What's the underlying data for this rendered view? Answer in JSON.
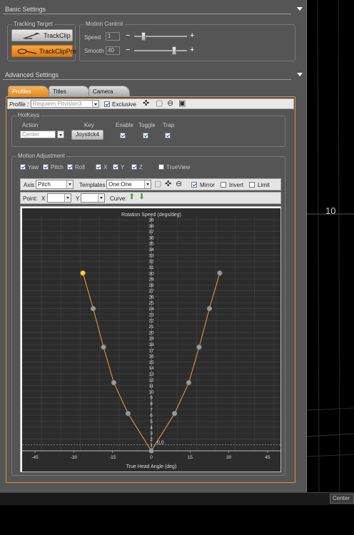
{
  "basic_settings": {
    "title": "Basic Settings"
  },
  "tracking_target": {
    "title": "Tracking Target",
    "trackclip_label": "TrackClip",
    "trackclippro_label": "TrackClipPro"
  },
  "motion_control": {
    "title": "Motion Control",
    "speed_label": "Speed",
    "speed_value": "1",
    "speed_level": 0.18,
    "smooth_label": "Smooth",
    "smooth_value": "40",
    "smooth_level": 0.75,
    "minus": "−",
    "plus": "+"
  },
  "advanced_settings": {
    "title": "Advanced Settings"
  },
  "tabs": {
    "profiles": "Profiles",
    "titles": "Titles",
    "camera": "Camera"
  },
  "profile": {
    "label": "Profile :",
    "value": "Requiem Pitvision3",
    "exclusive_label": "Exclusive",
    "exclusive_checked": true
  },
  "hotkeys": {
    "title": "HotKeys",
    "col_action": "Action",
    "col_key": "Key",
    "col_enable": "Enable",
    "col_toggle": "Toggle",
    "col_trap": "Trap",
    "action_value": "Center",
    "key_value": "Joystick4",
    "enable_checked": true,
    "toggle_checked": true,
    "trap_checked": true
  },
  "motion_adjustment": {
    "title": "Motion Adjustment",
    "axes": [
      {
        "label": "Yaw",
        "checked": true
      },
      {
        "label": "Pitch",
        "checked": true
      },
      {
        "label": "Roll",
        "checked": true
      },
      {
        "label": "X",
        "checked": true
      },
      {
        "label": "Y",
        "checked": true
      },
      {
        "label": "Z",
        "checked": true
      }
    ],
    "trueview_label": "TrueView",
    "trueview_checked": false
  },
  "curve_toolbar": {
    "axis_label": "Axis",
    "axis_value": "Pitch",
    "templates_label": "Templates",
    "templates_value": "One:One",
    "mirror_label": "Mirror",
    "mirror_checked": true,
    "invert_label": "Invert",
    "invert_checked": false,
    "limit_label": "Limit",
    "limit_checked": false,
    "point_label": "Point:",
    "x_label": "X",
    "y_label": "Y",
    "curve_label": "Curve:"
  },
  "chart_data": {
    "type": "line",
    "title": "Rotation Speed (degs/deg)",
    "xlabel": "True Head Angle (deg)",
    "ylabel": "",
    "xlim": [
      -50,
      50
    ],
    "ylim": [
      0,
      39
    ],
    "x_ticks": [
      -45,
      -30,
      -15,
      0,
      15,
      30,
      45
    ],
    "y_ticks": [
      1,
      2,
      3,
      4,
      5,
      6,
      7,
      8,
      9,
      10,
      11,
      12,
      13,
      14,
      15,
      16,
      17,
      18,
      19,
      20,
      21,
      22,
      23,
      24,
      25,
      26,
      27,
      28,
      29,
      30,
      31,
      32,
      33,
      34,
      35,
      36,
      37,
      38,
      39
    ],
    "origin_label": "0,0",
    "zero_line_y": 1,
    "series": [
      {
        "points": [
          {
            "x": -26.5,
            "y": 30,
            "selected": true
          },
          {
            "x": -22.5,
            "y": 24
          },
          {
            "x": -18.5,
            "y": 17.5
          },
          {
            "x": -14.5,
            "y": 11.5
          },
          {
            "x": -9,
            "y": 6.3
          },
          {
            "x": 0,
            "y": 0
          },
          {
            "x": 9,
            "y": 6.3
          },
          {
            "x": 14.5,
            "y": 11.5
          },
          {
            "x": 18.5,
            "y": 17.5
          },
          {
            "x": 22.5,
            "y": 24
          },
          {
            "x": 26.5,
            "y": 30
          }
        ]
      }
    ],
    "line_color": "#e8a040",
    "grid": true
  },
  "background": {
    "value_label": "10"
  },
  "bottom_tab": {
    "label": "Center"
  },
  "colors": {
    "accent": "#e8902a",
    "panel": "#555555",
    "plot_bg": "#2c2c2c"
  }
}
